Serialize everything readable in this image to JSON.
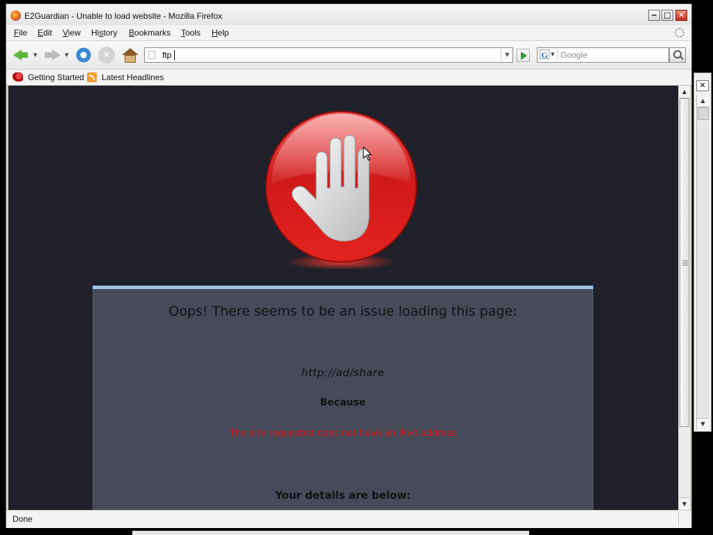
{
  "window": {
    "title": "E2Guardian - Unable to load website - Mozilla Firefox",
    "controls": {
      "minimize": "‒",
      "maximize": "□",
      "close": "✕"
    }
  },
  "menu": {
    "items": [
      {
        "label": "File",
        "mnemonic": "F",
        "rest": "ile"
      },
      {
        "label": "Edit",
        "mnemonic": "E",
        "rest": "dit"
      },
      {
        "label": "View",
        "mnemonic": "V",
        "rest": "iew"
      },
      {
        "label": "History",
        "mnemonic": "H",
        "rest": "istory",
        "pre": ""
      },
      {
        "label": "Bookmarks",
        "mnemonic": "B",
        "rest": "ookmarks"
      },
      {
        "label": "Tools",
        "mnemonic": "T",
        "rest": "ools"
      },
      {
        "label": "Help",
        "mnemonic": "H",
        "rest": "elp"
      }
    ]
  },
  "navigation": {
    "url_value": "ftp",
    "search_engine": "G",
    "search_placeholder": "Google"
  },
  "bookmarks": {
    "items": [
      {
        "label": "Getting Started",
        "icon": "firefox-getting-started-icon"
      },
      {
        "label": "Latest Headlines",
        "icon": "rss-feed-icon"
      }
    ]
  },
  "page": {
    "heading": "Oops! There seems to be an issue loading this page:",
    "blocked_url": "http://ad/share",
    "because_label": "Because",
    "reason": "The site requested does not have an IPv4 address",
    "details_label": "Your details are below:",
    "image": "stop-hand-icon"
  },
  "status": {
    "text": "Done"
  },
  "colors": {
    "page_background": "#1f2029",
    "panel_background": "#464a59",
    "panel_accent": "#9fc3e8",
    "reason_red": "#d7191c",
    "stop_sign_red": "#d71f1f"
  }
}
